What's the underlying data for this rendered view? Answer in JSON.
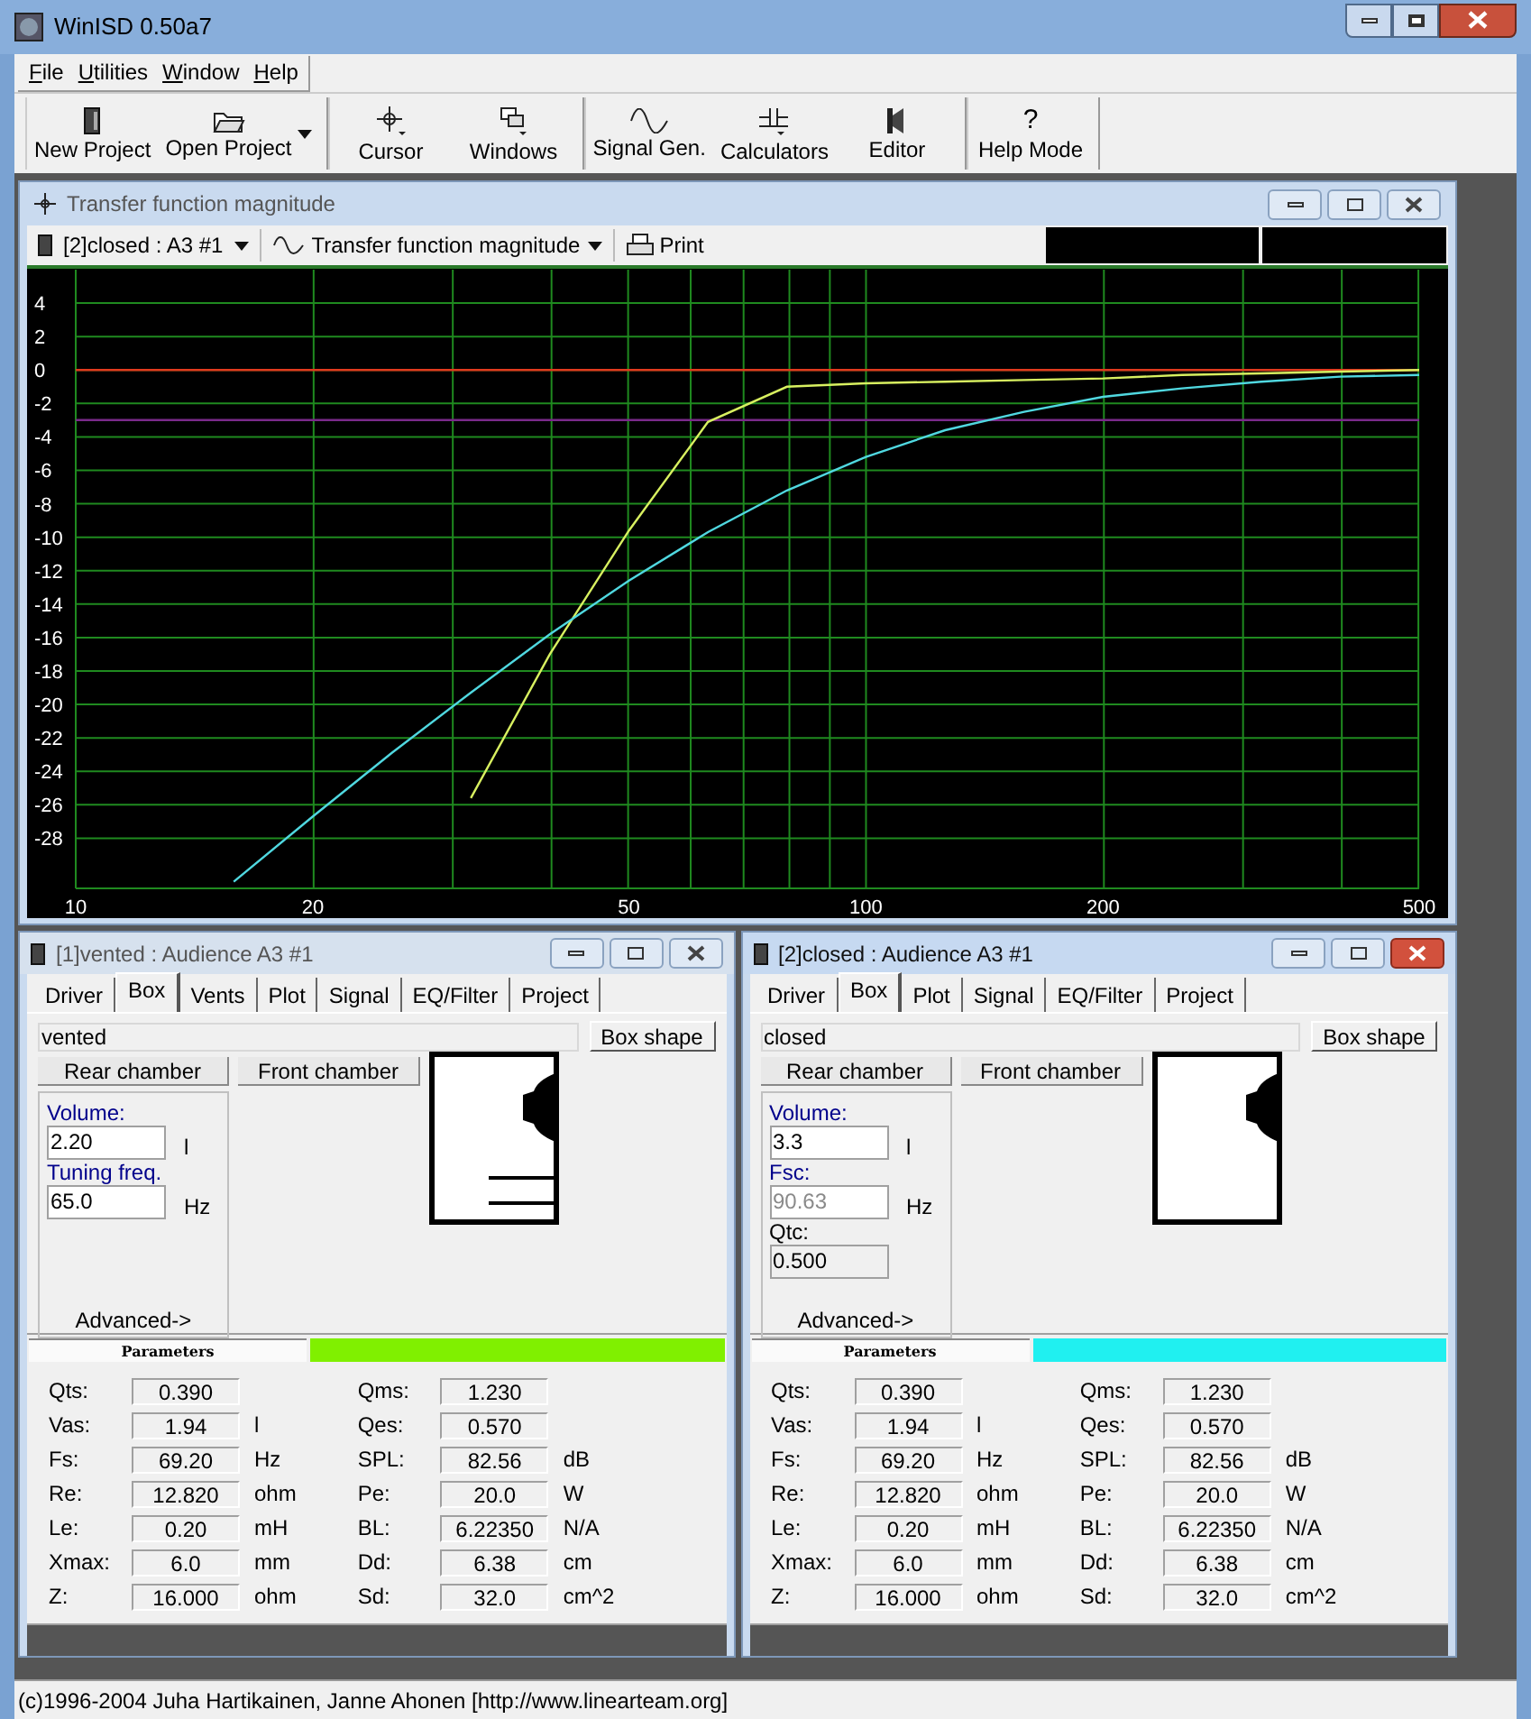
{
  "window": {
    "title": "WinISD 0.50a7"
  },
  "menu": [
    {
      "label": "File"
    },
    {
      "label": "Utilities"
    },
    {
      "label": "Window"
    },
    {
      "label": "Help"
    }
  ],
  "toolbar": {
    "groups": [
      [
        {
          "label": "New Project",
          "kind": "document",
          "dropdown": false
        },
        {
          "label": "Open Project",
          "kind": "folder",
          "dropdown": true
        }
      ],
      [
        {
          "label": "Cursor",
          "kind": "crosshair",
          "dropdown": false
        },
        {
          "label": "Windows",
          "kind": "windows",
          "dropdown": false
        }
      ],
      [
        {
          "label": "Signal Gen.",
          "kind": "sine",
          "dropdown": false
        },
        {
          "label": "Calculators",
          "kind": "calculator",
          "dropdown": false
        },
        {
          "label": "Editor",
          "kind": "speaker",
          "dropdown": false
        }
      ],
      [
        {
          "label": "Help Mode",
          "kind": "glyph",
          "glyph": "?",
          "dropdown": false
        }
      ]
    ]
  },
  "chart_window": {
    "title": "Transfer function magnitude",
    "project": "[2]closed : A3 #1",
    "plot": "Transfer function magnitude",
    "print": "Print",
    "chart_data": {
      "type": "line",
      "categories": [
        "10",
        null,
        null,
        "20",
        null,
        null,
        null,
        "50",
        null,
        null,
        "100",
        null,
        null,
        "200",
        null,
        null,
        null,
        "500"
      ],
      "series": [
        {
          "color": "#e03a1e",
          "values": [
            0,
            0,
            0,
            0,
            0,
            0,
            0,
            0,
            0,
            0,
            0,
            0,
            0,
            0,
            0,
            0,
            0,
            0
          ]
        },
        {
          "color": "#7a2a8a",
          "values": [
            -3,
            -3,
            -3,
            -3,
            -3,
            -3,
            -3,
            -3,
            -3,
            -3,
            -3,
            -3,
            -3,
            -3,
            -3,
            -3,
            -3,
            -3
          ]
        },
        {
          "color": "#d8f060",
          "values": [
            null,
            null,
            null,
            null,
            null,
            -25.6,
            -17,
            -9.6,
            -3.1,
            -1,
            -0.8,
            -0.7,
            -0.6,
            -0.5,
            -0.3,
            -0.2,
            -0.1,
            0
          ]
        },
        {
          "color": "#50d8e0",
          "values": [
            null,
            null,
            -30.6,
            -26.7,
            -22.9,
            -19.3,
            -15.8,
            -12.6,
            -9.7,
            -7.2,
            -5.2,
            -3.6,
            -2.5,
            -1.6,
            -1.1,
            -0.7,
            -0.4,
            -0.3
          ]
        }
      ],
      "ylim": [
        -31,
        6
      ],
      "grid": true,
      "yticks": [
        4,
        2,
        0,
        -2,
        -4,
        -6,
        -8,
        -10,
        -12,
        -14,
        -16,
        -18,
        -20,
        -22,
        -24,
        -26,
        -28
      ]
    }
  },
  "panels": [
    {
      "title": "[1]vented : Audience A3 #1",
      "active": false,
      "kind": "vented",
      "color": "#80f000",
      "tabs": [
        {
          "label": "Driver",
          "selected": false
        },
        {
          "label": "Box",
          "selected": true
        },
        {
          "label": "Vents",
          "selected": false
        },
        {
          "label": "Plot",
          "selected": false
        },
        {
          "label": "Signal",
          "selected": false
        },
        {
          "label": "EQ/Filter",
          "selected": false
        },
        {
          "label": "Project",
          "selected": false
        }
      ],
      "box_name": "vented",
      "box_shape": "Box shape",
      "rear": "Rear chamber",
      "front": "Front chamber",
      "fields": [
        {
          "label": "Volume:",
          "value": "2.20",
          "unit": "l",
          "kind": "editable"
        },
        {
          "label": "Tuning freq.",
          "value": "65.0",
          "unit": "Hz",
          "kind": "editable"
        }
      ],
      "advanced": "Advanced->",
      "params_title": "Parameters",
      "params_left": [
        {
          "label": "Qts:",
          "value": "0.390"
        },
        {
          "label": "Vas:",
          "value": "1.94",
          "unit": "l"
        },
        {
          "label": "Fs:",
          "value": "69.20",
          "unit": "Hz"
        },
        {
          "label": "Re:",
          "value": "12.820",
          "unit": "ohm"
        },
        {
          "label": "Le:",
          "value": "0.20",
          "unit": "mH"
        },
        {
          "label": "Xmax:",
          "value": "6.0",
          "unit": "mm"
        },
        {
          "label": "Z:",
          "value": "16.000",
          "unit": "ohm"
        }
      ],
      "params_right": [
        {
          "label": "Qms:",
          "value": "1.230"
        },
        {
          "label": "Qes:",
          "value": "0.570"
        },
        {
          "label": "SPL:",
          "value": "82.56",
          "unit": "dB"
        },
        {
          "label": "Pe:",
          "value": "20.0",
          "unit": "W"
        },
        {
          "label": "BL:",
          "value": "6.22350",
          "unit": "N/A"
        },
        {
          "label": "Dd:",
          "value": "6.38",
          "unit": "cm"
        },
        {
          "label": "Sd:",
          "value": "32.0",
          "unit": "cm^2"
        }
      ]
    },
    {
      "title": "[2]closed : Audience A3 #1",
      "active": true,
      "kind": "closed",
      "color": "#20f0f0",
      "tabs": [
        {
          "label": "Driver",
          "selected": false
        },
        {
          "label": "Box",
          "selected": true
        },
        {
          "label": "Plot",
          "selected": false
        },
        {
          "label": "Signal",
          "selected": false
        },
        {
          "label": "EQ/Filter",
          "selected": false
        },
        {
          "label": "Project",
          "selected": false
        }
      ],
      "box_name": "closed",
      "box_shape": "Box shape",
      "rear": "Rear chamber",
      "front": "Front chamber",
      "fields": [
        {
          "label": "Volume:",
          "value": "3.3",
          "unit": "l",
          "kind": "editable"
        },
        {
          "label": "Fsc:",
          "value": "90.63",
          "unit": "Hz",
          "kind": "dimmed"
        },
        {
          "label": "Qtc:",
          "value": "0.500",
          "kind": "readonly"
        }
      ],
      "advanced": "Advanced->",
      "params_title": "Parameters",
      "params_left": [
        {
          "label": "Qts:",
          "value": "0.390"
        },
        {
          "label": "Vas:",
          "value": "1.94",
          "unit": "l"
        },
        {
          "label": "Fs:",
          "value": "69.20",
          "unit": "Hz"
        },
        {
          "label": "Re:",
          "value": "12.820",
          "unit": "ohm"
        },
        {
          "label": "Le:",
          "value": "0.20",
          "unit": "mH"
        },
        {
          "label": "Xmax:",
          "value": "6.0",
          "unit": "mm"
        },
        {
          "label": "Z:",
          "value": "16.000",
          "unit": "ohm"
        }
      ],
      "params_right": [
        {
          "label": "Qms:",
          "value": "1.230"
        },
        {
          "label": "Qes:",
          "value": "0.570"
        },
        {
          "label": "SPL:",
          "value": "82.56",
          "unit": "dB"
        },
        {
          "label": "Pe:",
          "value": "20.0",
          "unit": "W"
        },
        {
          "label": "BL:",
          "value": "6.22350",
          "unit": "N/A"
        },
        {
          "label": "Dd:",
          "value": "6.38",
          "unit": "cm"
        },
        {
          "label": "Sd:",
          "value": "32.0",
          "unit": "cm^2"
        }
      ]
    }
  ],
  "status_bar": "(c)1996-2004 Juha Hartikainen, Janne Ahonen [http://www.linearteam.org]"
}
